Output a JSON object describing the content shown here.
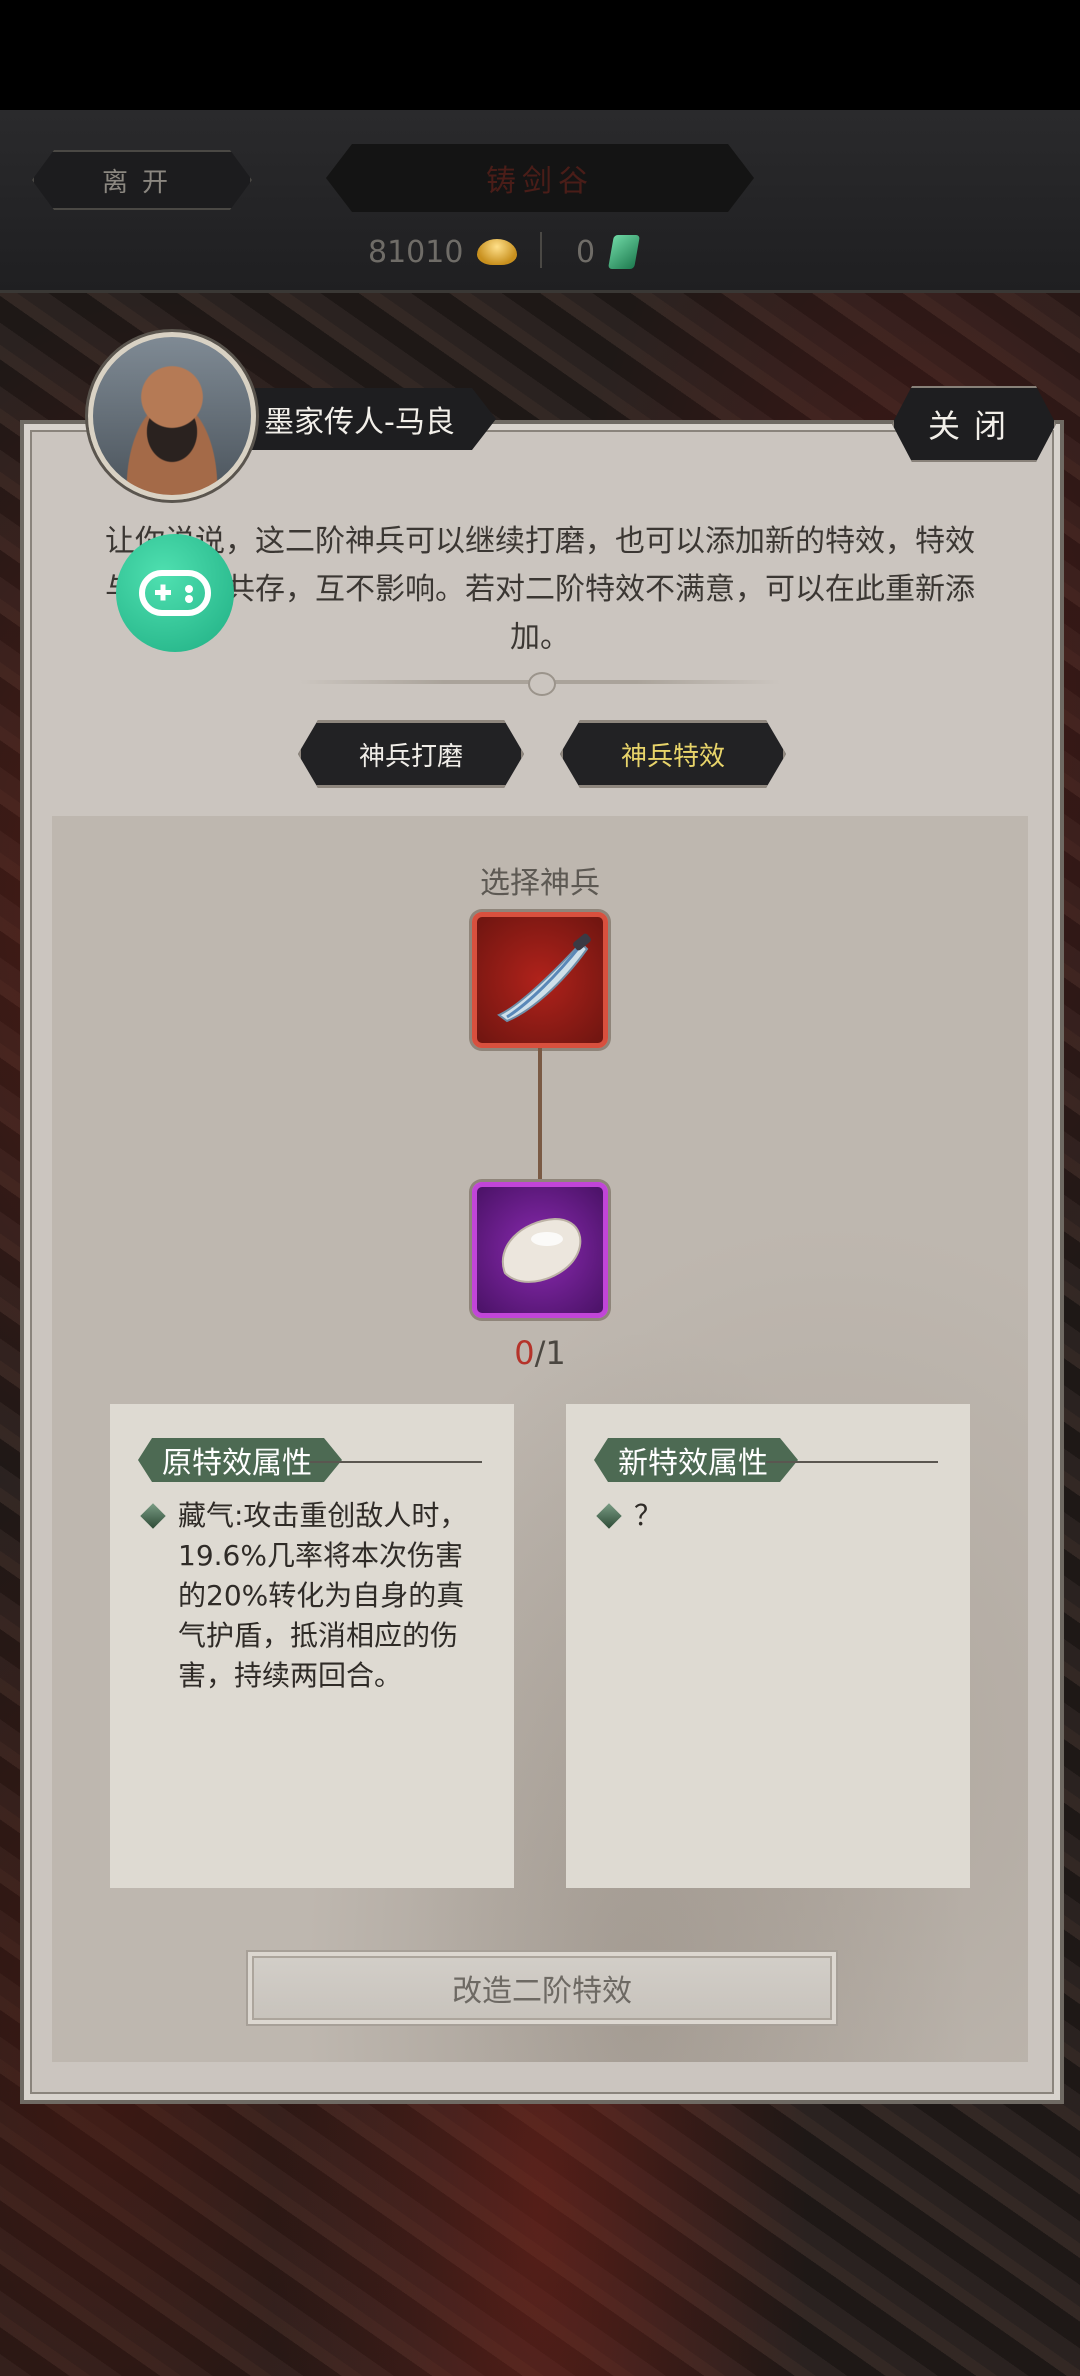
{
  "header": {
    "leave_label": "离开",
    "location_title": "铸剑谷",
    "gold_amount": "81010",
    "jade_amount": "0"
  },
  "npc": {
    "name": "墨家传人-马良",
    "close_label": "关闭",
    "intro_text": "让你说说，这二阶神兵可以继续打磨，也可以添加新的特效，特效与原特效共存，互不影响。若对二阶特效不满意，可以在此重新添加。"
  },
  "tabs": [
    {
      "label": "神兵打磨",
      "active": false
    },
    {
      "label": "神兵特效",
      "active": true
    }
  ],
  "forge": {
    "select_label": "选择神兵",
    "material_current": "0",
    "material_total": "/1"
  },
  "attributes": {
    "old_title": "原特效属性",
    "old_text": "藏气:攻击重创敌人时，19.6%几率将本次伤害的20%转化为自身的真气护盾，抵消相应的伤害，持续两回合。",
    "new_title": "新特效属性",
    "new_text": "？"
  },
  "action": {
    "modify_label": "改造二阶特效"
  },
  "colors": {
    "accent_gold": "#e8d46a",
    "weapon_slot": "#d8503e",
    "gem_slot": "#c145d8",
    "attr_header": "#4d6a53"
  },
  "icons": {
    "gold": "gold-ingot-icon",
    "jade": "jade-icon",
    "fab": "gamepad-icon"
  }
}
